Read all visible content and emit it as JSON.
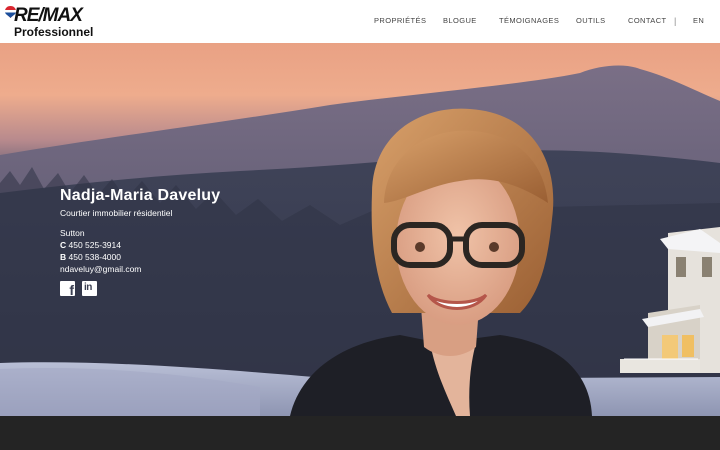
{
  "brand": {
    "logo_text": "RE/MAX",
    "logo_sub": "Professionnel"
  },
  "nav": {
    "items": [
      {
        "label": "PROPRIÉTÉS"
      },
      {
        "label": "BLOGUE"
      },
      {
        "label": "TÉMOIGNAGES"
      },
      {
        "label": "OUTILS"
      },
      {
        "label": "CONTACT"
      }
    ],
    "separator": "|",
    "lang": "EN"
  },
  "agent": {
    "name": "Nadja-Maria Daveluy",
    "title": "Courtier immobilier résidentiel",
    "city": "Sutton",
    "cell_prefix": "C",
    "cell": "450 525-3914",
    "office_prefix": "B",
    "office": "450 538-4000",
    "email": "ndaveluy@gmail.com"
  },
  "social": {
    "facebook_glyph": "f",
    "linkedin_glyph": "in",
    "icons": [
      "facebook-icon",
      "linkedin-icon"
    ]
  },
  "colors": {
    "header_bg": "#ffffff",
    "footer_bg": "#242424",
    "sky_top": "#e9a184",
    "mountain": "#4a4c63"
  }
}
